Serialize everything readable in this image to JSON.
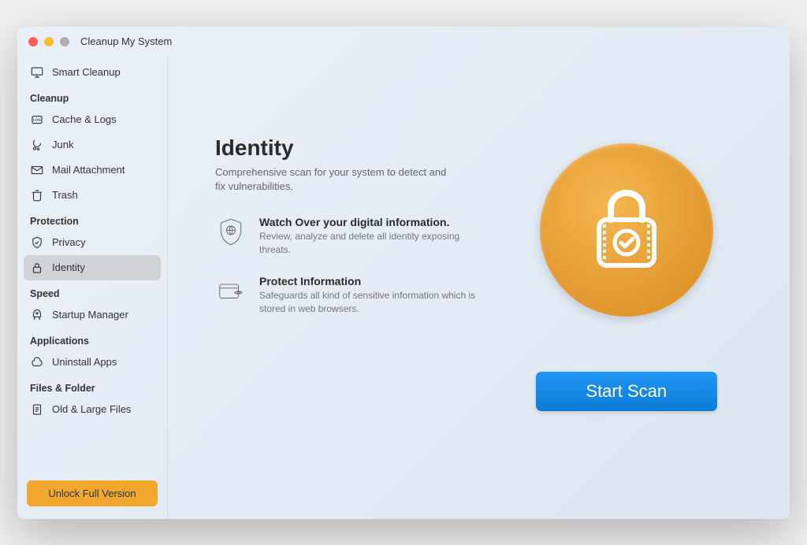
{
  "app": {
    "title": "Cleanup My System"
  },
  "sidebar": {
    "top_item": "Smart Cleanup",
    "sections": {
      "cleanup": {
        "header": "Cleanup",
        "items": [
          "Cache & Logs",
          "Junk",
          "Mail Attachment",
          "Trash"
        ]
      },
      "protection": {
        "header": "Protection",
        "items": [
          "Privacy",
          "Identity"
        ]
      },
      "speed": {
        "header": "Speed",
        "items": [
          "Startup Manager"
        ]
      },
      "applications": {
        "header": "Applications",
        "items": [
          "Uninstall Apps"
        ]
      },
      "files": {
        "header": "Files & Folder",
        "items": [
          "Old & Large Files"
        ]
      }
    },
    "unlock_label": "Unlock Full Version"
  },
  "content": {
    "title": "Identity",
    "subtitle": "Comprehensive scan for your system to detect and fix vulnerabilities.",
    "features": [
      {
        "title": "Watch Over your digital information.",
        "desc": "Review, analyze and delete all identity exposing threats."
      },
      {
        "title": "Protect Information",
        "desc": "Safeguards all kind of sensitive information which is stored in web browsers."
      }
    ],
    "start_button": "Start Scan"
  }
}
